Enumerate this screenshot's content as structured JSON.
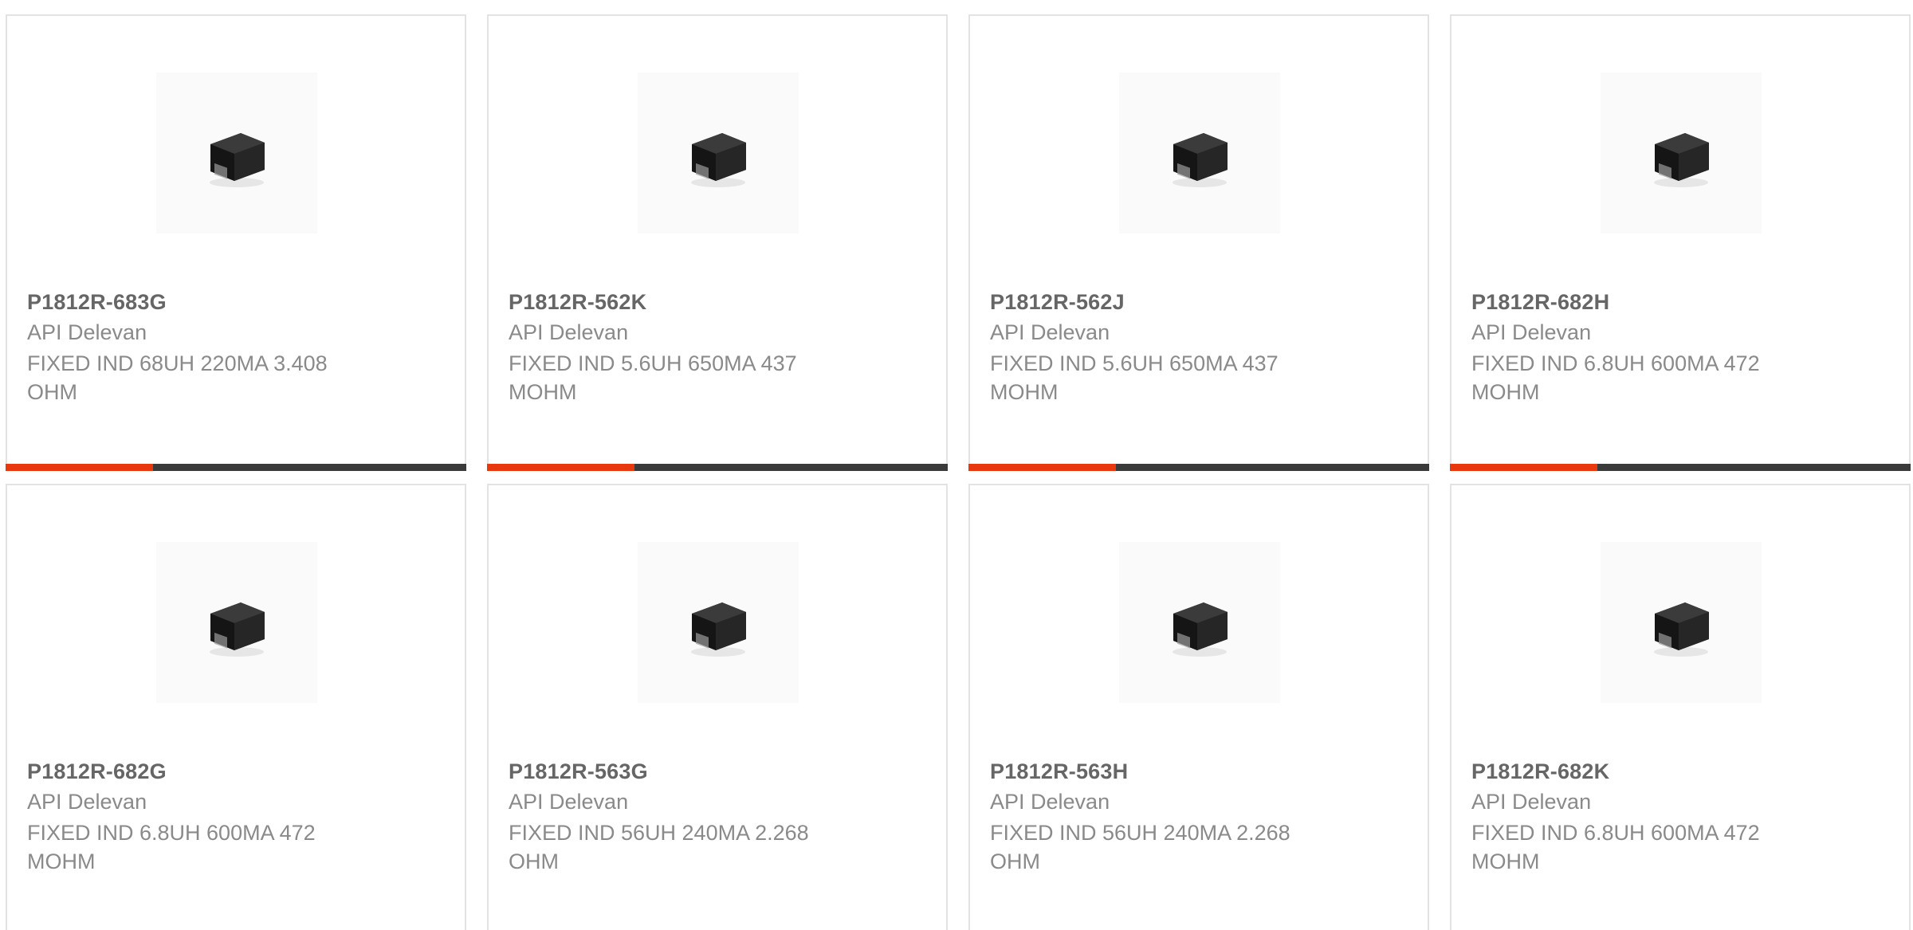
{
  "colors": {
    "accent": "#e8380d",
    "bar": "#3a3a3a",
    "border": "#e3e3e3",
    "title": "#666666",
    "text": "#8a8a8a"
  },
  "product_image_icon": "inductor-chip-icon",
  "products": [
    {
      "part_number": "P1812R-683G",
      "manufacturer": "API Delevan",
      "description": "FIXED IND 68UH 220MA 3.408 OHM"
    },
    {
      "part_number": "P1812R-562K",
      "manufacturer": "API Delevan",
      "description": "FIXED IND 5.6UH 650MA 437 MOHM"
    },
    {
      "part_number": "P1812R-562J",
      "manufacturer": "API Delevan",
      "description": "FIXED IND 5.6UH 650MA 437 MOHM"
    },
    {
      "part_number": "P1812R-682H",
      "manufacturer": "API Delevan",
      "description": "FIXED IND 6.8UH 600MA 472 MOHM"
    },
    {
      "part_number": "P1812R-682G",
      "manufacturer": "API Delevan",
      "description": "FIXED IND 6.8UH 600MA 472 MOHM"
    },
    {
      "part_number": "P1812R-563G",
      "manufacturer": "API Delevan",
      "description": "FIXED IND 56UH 240MA 2.268 OHM"
    },
    {
      "part_number": "P1812R-563H",
      "manufacturer": "API Delevan",
      "description": "FIXED IND 56UH 240MA 2.268 OHM"
    },
    {
      "part_number": "P1812R-682K",
      "manufacturer": "API Delevan",
      "description": "FIXED IND 6.8UH 600MA 472 MOHM"
    }
  ]
}
